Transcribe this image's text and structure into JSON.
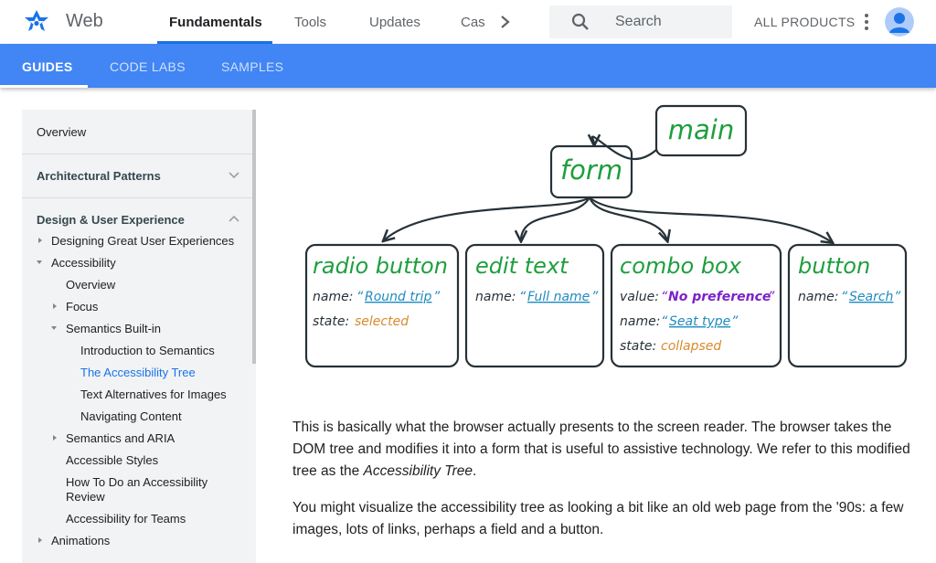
{
  "header": {
    "product": "Web",
    "tabs": [
      {
        "label": "Fundamentals",
        "active": true
      },
      {
        "label": "Tools"
      },
      {
        "label": "Updates"
      },
      {
        "label": "Cas"
      }
    ],
    "search_placeholder": "Search",
    "all_products": "ALL PRODUCTS",
    "icons": [
      "web-logo-icon",
      "chevron-right-icon",
      "search-icon",
      "more-vert-icon",
      "account-avatar-icon"
    ]
  },
  "subnav": {
    "tabs": [
      {
        "label": "GUIDES",
        "active": true
      },
      {
        "label": "CODE LABS"
      },
      {
        "label": "SAMPLES"
      }
    ]
  },
  "sidebar": {
    "overview": "Overview",
    "architectural_patterns": "Architectural Patterns",
    "design_ux": "Design & User Experience",
    "items": {
      "designing": "Designing Great User Experiences",
      "accessibility": "Accessibility",
      "acc_overview": "Overview",
      "focus": "Focus",
      "semantics_builtin": "Semantics Built-in",
      "intro_semantics": "Introduction to Semantics",
      "acc_tree": "The Accessibility Tree",
      "text_alternatives": "Text Alternatives for Images",
      "navigating_content": "Navigating Content",
      "semantics_aria": "Semantics and ARIA",
      "accessible_styles": "Accessible Styles",
      "howto_review_1": "How To Do an Accessibility",
      "howto_review_2": "Review",
      "acc_teams": "Accessibility for Teams",
      "animations": "Animations"
    }
  },
  "diagram": {
    "main": "main",
    "form": "form",
    "nodes": {
      "radio": {
        "title": "radio button",
        "name_key": "name:",
        "name_val": "Round trip",
        "state_key": "state:",
        "state_val": "selected"
      },
      "edit": {
        "title": "edit text",
        "name_key": "name:",
        "name_val": "Full name"
      },
      "combo": {
        "title": "combo box",
        "value_key": "value:",
        "value_val": "No preference",
        "name_key": "name:",
        "name_val": "Seat type",
        "state_key": "state:",
        "state_val": "collapsed"
      },
      "button": {
        "title": "button",
        "name_key": "name:",
        "name_val": "Search"
      }
    },
    "colors": {
      "green": "#1e9e3e",
      "blue": "#1f8bbf",
      "purple": "#7b22c9",
      "orange": "#d98a2b",
      "outline": "#263238"
    }
  },
  "content": {
    "p1_a": "This is basically what the browser actually presents to the screen reader. The browser takes the DOM tree and modifies it into a form that is useful to assistive technology. We refer to this modified tree as the ",
    "p1_em": "Accessibility Tree",
    "p1_b": ".",
    "p2": "You might visualize the accessibility tree as looking a bit like an old web page from the '90s: a few images, lots of links, perhaps a field and a button."
  },
  "colors": {
    "accent": "#4285f4",
    "link": "#1a73e8"
  }
}
